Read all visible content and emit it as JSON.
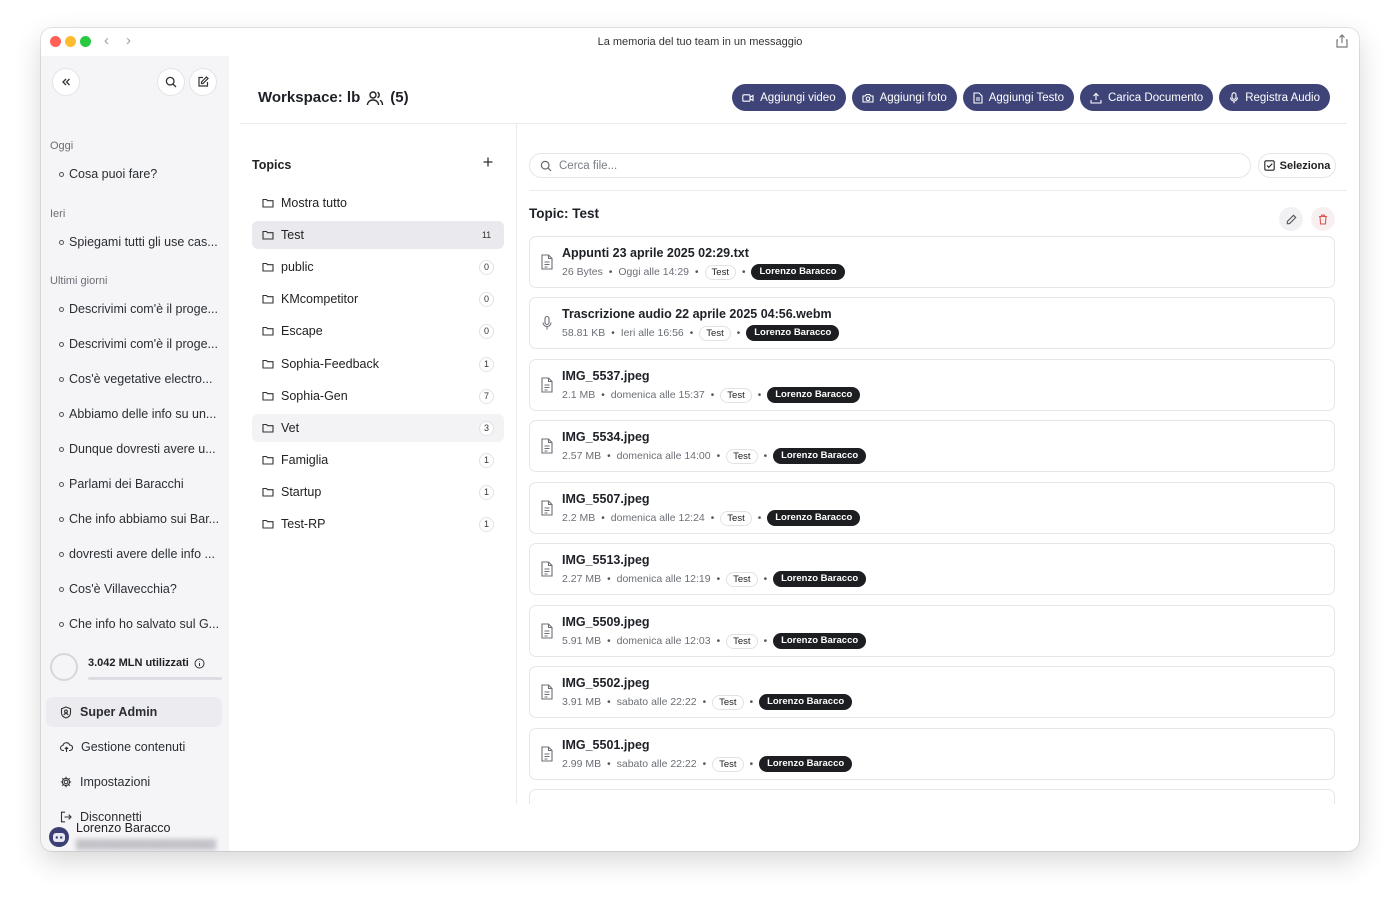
{
  "window": {
    "title": "La memoria del tuo team in un messaggio"
  },
  "sidebar": {
    "sections": [
      {
        "label": "Oggi",
        "items": [
          "Cosa puoi fare?"
        ]
      },
      {
        "label": "Ieri",
        "items": [
          "Spiegami tutti gli use cas..."
        ]
      },
      {
        "label": "Ultimi giorni",
        "items": [
          "Descrivimi com'è il proge...",
          "Descrivimi com'è il proge...",
          "Cos'è vegetative electro...",
          "Abbiamo delle info su un...",
          "Dunque dovresti avere u...",
          "Parlami dei Baracchi",
          "Che info abbiamo sui Bar...",
          "dovresti avere delle info ...",
          "Cos'è Villavecchia?",
          "Che info ho salvato sul G..."
        ]
      }
    ],
    "usage": {
      "label": "3.042 MLN utilizzati",
      "icon": "info-icon"
    },
    "menu": [
      {
        "label": "Super Admin",
        "icon": "shield-icon",
        "active": true
      },
      {
        "label": "Gestione contenuti",
        "icon": "cloud-upload-icon"
      },
      {
        "label": "Impostazioni",
        "icon": "gear-icon"
      },
      {
        "label": "Disconnetti",
        "icon": "logout-icon"
      }
    ],
    "user": {
      "name": "Lorenzo Baracco"
    }
  },
  "header": {
    "workspace_label": "Workspace: lb",
    "member_count": "(5)",
    "actions": [
      {
        "label": "Aggiungi video",
        "icon": "video-icon"
      },
      {
        "label": "Aggiungi foto",
        "icon": "camera-icon"
      },
      {
        "label": "Aggiungi Testo",
        "icon": "document-icon"
      },
      {
        "label": "Carica Documento",
        "icon": "upload-icon"
      },
      {
        "label": "Registra Audio",
        "icon": "mic-icon"
      }
    ]
  },
  "topics": {
    "title": "Topics",
    "items": [
      {
        "name": "Mostra tutto",
        "count": null
      },
      {
        "name": "Test",
        "count": "11",
        "active": true
      },
      {
        "name": "public",
        "count": "0"
      },
      {
        "name": "KMcompetitor",
        "count": "0"
      },
      {
        "name": "Escape",
        "count": "0"
      },
      {
        "name": "Sophia-Feedback",
        "count": "1"
      },
      {
        "name": "Sophia-Gen",
        "count": "7"
      },
      {
        "name": "Vet",
        "count": "3",
        "highlight": true
      },
      {
        "name": "Famiglia",
        "count": "1"
      },
      {
        "name": "Startup",
        "count": "1"
      },
      {
        "name": "Test-RP",
        "count": "1"
      }
    ]
  },
  "files": {
    "search_placeholder": "Cerca file...",
    "select_label": "Seleziona",
    "topic_title": "Topic: Test",
    "items": [
      {
        "name": "Appunti 23 aprile 2025 02:29.txt",
        "size": "26 Bytes",
        "date": "Oggi alle 14:29",
        "tag": "Test",
        "owner": "Lorenzo Baracco",
        "icon": "document-icon"
      },
      {
        "name": "Trascrizione audio 22 aprile 2025 04:56.webm",
        "size": "58.81 KB",
        "date": "Ieri alle 16:56",
        "tag": "Test",
        "owner": "Lorenzo Baracco",
        "icon": "mic-icon"
      },
      {
        "name": "IMG_5537.jpeg",
        "size": "2.1 MB",
        "date": "domenica alle 15:37",
        "tag": "Test",
        "owner": "Lorenzo Baracco",
        "icon": "document-icon"
      },
      {
        "name": "IMG_5534.jpeg",
        "size": "2.57 MB",
        "date": "domenica alle 14:00",
        "tag": "Test",
        "owner": "Lorenzo Baracco",
        "icon": "document-icon"
      },
      {
        "name": "IMG_5507.jpeg",
        "size": "2.2 MB",
        "date": "domenica alle 12:24",
        "tag": "Test",
        "owner": "Lorenzo Baracco",
        "icon": "document-icon"
      },
      {
        "name": "IMG_5513.jpeg",
        "size": "2.27 MB",
        "date": "domenica alle 12:19",
        "tag": "Test",
        "owner": "Lorenzo Baracco",
        "icon": "document-icon"
      },
      {
        "name": "IMG_5509.jpeg",
        "size": "5.91 MB",
        "date": "domenica alle 12:03",
        "tag": "Test",
        "owner": "Lorenzo Baracco",
        "icon": "document-icon"
      },
      {
        "name": "IMG_5502.jpeg",
        "size": "3.91 MB",
        "date": "sabato alle 22:22",
        "tag": "Test",
        "owner": "Lorenzo Baracco",
        "icon": "document-icon"
      },
      {
        "name": "IMG_5501.jpeg",
        "size": "2.99 MB",
        "date": "sabato alle 22:22",
        "tag": "Test",
        "owner": "Lorenzo Baracco",
        "icon": "document-icon"
      },
      {
        "name": "",
        "size": "",
        "date": "",
        "tag": "",
        "owner": "",
        "icon": "document-icon"
      }
    ]
  },
  "colors": {
    "accent": "#3f4478",
    "owner_badge": "#1c1e22",
    "sidebar_bg": "#f5f5f8"
  }
}
